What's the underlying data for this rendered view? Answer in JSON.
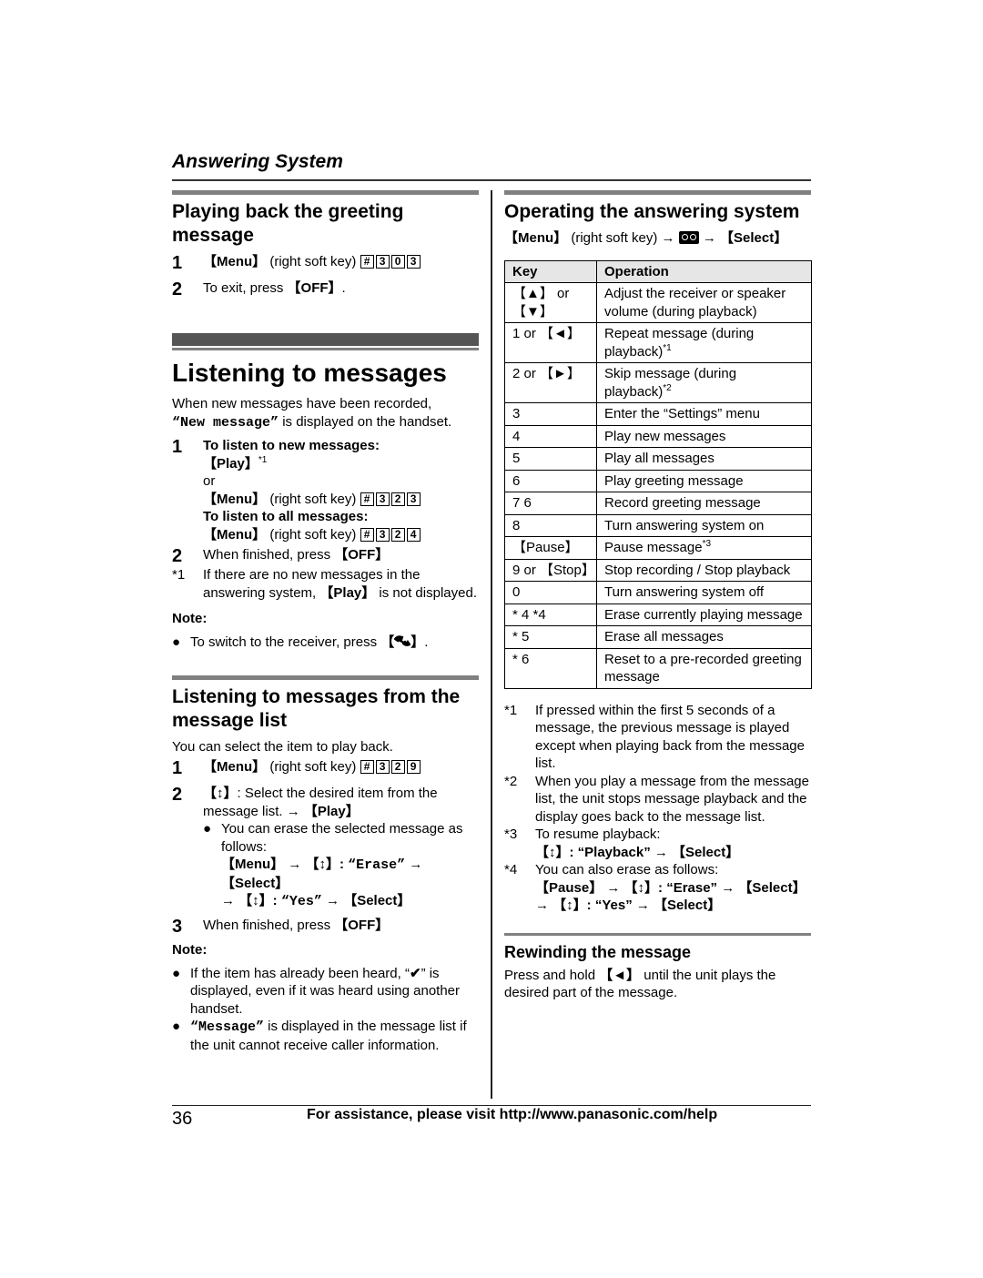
{
  "header": {
    "running_head": "Answering System"
  },
  "greeting": {
    "title": "Playing back the greeting message",
    "steps": [
      {
        "num": "1",
        "menu": "【Menu】",
        "mid": " (right soft key) ",
        "keys": [
          "#",
          "3",
          "0",
          "3"
        ]
      },
      {
        "num": "2",
        "pre": "To exit, press ",
        "btn": "【OFF】",
        "post": "."
      }
    ]
  },
  "listening": {
    "title": "Listening to messages",
    "intro_1": "When new messages have been recorded,",
    "intro_quote": "“New message”",
    "intro_2": " is displayed on the handset.",
    "step1_num": "1",
    "step1_heading_new": "To listen to new messages:",
    "step1_play": "【Play】",
    "step1_play_sup": "*1",
    "step1_or": "or",
    "step1_menu": "【Menu】",
    "step1_mid": " (right soft key) ",
    "step1_keys_new": [
      "#",
      "3",
      "2",
      "3"
    ],
    "step1_heading_all": "To listen to all messages:",
    "step1_keys_all": [
      "#",
      "3",
      "2",
      "4"
    ],
    "step2_num": "2",
    "step2_pre": "When finished, press ",
    "step2_btn": "【OFF】",
    "fn1_mark": "*1",
    "fn1_pre": "If there are no new messages in the answering system, ",
    "fn1_btn": "【Play】",
    "fn1_post": " is not displayed.",
    "note_label": "Note:",
    "note_pre": "To switch to the receiver, press ",
    "note_post": "."
  },
  "from_list": {
    "title": "Listening to messages from the message list",
    "intro": "You can select the item to play back.",
    "step1_num": "1",
    "step1_menu": "【Menu】",
    "step1_mid": " (right soft key) ",
    "step1_keys": [
      "#",
      "3",
      "2",
      "9"
    ],
    "step2_num": "2",
    "step2_nav": "【↕】",
    "step2_text": ": Select the desired item from the message list. → ",
    "step2_play": "【Play】",
    "step2_bullet": "You can erase the selected message as follows:",
    "step2_seq_1": "【Menu】 → 【↕】: ",
    "step2_seq_erase": "“Erase”",
    "step2_seq_2": " → 【Select】",
    "step2_seq_3": "→ 【↕】: ",
    "step2_seq_yes": "“Yes”",
    "step2_seq_4": " → 【Select】",
    "step3_num": "3",
    "step3_pre": "When finished, press ",
    "step3_btn": "【OFF】",
    "note_label": "Note:",
    "note1_pre": "If the item has already been heard, “",
    "note1_check": "✔",
    "note1_post": "” is displayed, even if it was heard using another handset.",
    "note2_quote": "“Message”",
    "note2_post": " is displayed in the message list if the unit cannot receive caller information."
  },
  "operating": {
    "title": "Operating the answering system",
    "path_menu": "【Menu】",
    "path_mid": " (right soft key) → ",
    "path_icon": "voicemail-icon",
    "path_end": " → 【Select】",
    "table_headers": [
      "Key",
      "Operation"
    ],
    "rows": [
      {
        "key": "【▲】 or 【▼】",
        "op": "Adjust the receiver or speaker volume (during playback)",
        "sup": ""
      },
      {
        "key": "1 or 【◄】",
        "op": "Repeat message (during playback)",
        "sup": "*1"
      },
      {
        "key": "2 or 【►】",
        "op": "Skip message (during playback)",
        "sup": "*2"
      },
      {
        "key": "3",
        "op": "Enter the “Settings” menu",
        "sup": ""
      },
      {
        "key": "4",
        "op": "Play new messages",
        "sup": ""
      },
      {
        "key": "5",
        "op": "Play all messages",
        "sup": ""
      },
      {
        "key": "6",
        "op": "Play greeting message",
        "sup": ""
      },
      {
        "key": "7 6",
        "op": "Record greeting message",
        "sup": ""
      },
      {
        "key": "8",
        "op": "Turn answering system on",
        "sup": ""
      },
      {
        "key": "【Pause】",
        "op": "Pause message",
        "sup": "*3"
      },
      {
        "key": "9 or 【Stop】",
        "op": "Stop recording / Stop playback",
        "sup": ""
      },
      {
        "key": "0",
        "op": "Turn answering system off",
        "sup": ""
      },
      {
        "key": "* 4 *4",
        "op": "Erase currently playing message",
        "sup": ""
      },
      {
        "key": "* 5",
        "op": "Erase all messages",
        "sup": ""
      },
      {
        "key": "* 6",
        "op": "Reset to a pre-recorded greeting message",
        "sup": ""
      }
    ],
    "footnotes": [
      {
        "mark": "*1",
        "text": "If pressed within the first 5 seconds of a message, the previous message is played except when playing back from the message list."
      },
      {
        "mark": "*2",
        "text": "When you play a message from the message list, the unit stops message playback and the display goes back to the message list."
      },
      {
        "mark": "*3",
        "text": "To resume playback:",
        "seq": "【↕】: “Playback” → 【Select】"
      },
      {
        "mark": "*4",
        "text": "You can also erase as follows:",
        "seq": "【Pause】 → 【↕】: “Erase” → 【Select】",
        "seq2": "→ 【↕】: “Yes” → 【Select】"
      }
    ]
  },
  "rewinding": {
    "title": "Rewinding the message",
    "text_pre": "Press and hold ",
    "text_btn": "【◄】",
    "text_post": " until the unit plays the desired part of the message."
  },
  "footer": {
    "page_number": "36",
    "assist_text": "For assistance, please visit http://www.panasonic.com/help"
  }
}
